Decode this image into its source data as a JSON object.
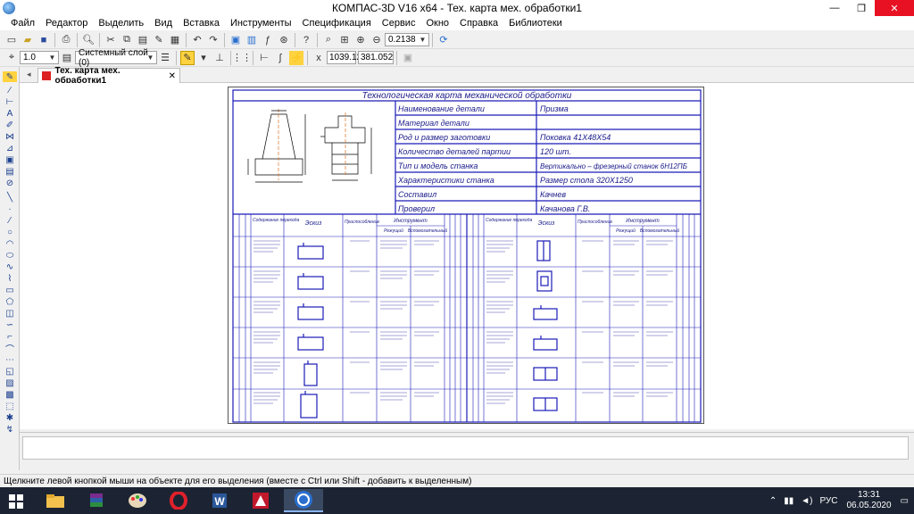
{
  "window": {
    "title": "КОМПАС-3D V16  x64 - Тех. карта мех. обработки1",
    "minimize": "—",
    "maximize": "❐",
    "close": "✕"
  },
  "menu": [
    "Файл",
    "Редактор",
    "Выделить",
    "Вид",
    "Вставка",
    "Инструменты",
    "Спецификация",
    "Сервис",
    "Окно",
    "Справка",
    "Библиотеки"
  ],
  "toolbar1": {
    "zoom_value": "0.2138"
  },
  "toolbar2": {
    "line_scale": "1.0",
    "layer": "Системный слой (0)",
    "coord_x": "1039.12",
    "coord_y": "381.052"
  },
  "tab": {
    "label": "Тех. карта мех. обработки1",
    "close": "✕"
  },
  "sheet": {
    "title": "Технологическая карта механической обработки",
    "info_rows": [
      {
        "label": "Наименование детали",
        "value": "Призма"
      },
      {
        "label": "Материал детали",
        "value": ""
      },
      {
        "label": "Род и размер заготовки",
        "value": "Поковка 41Х48Х54"
      },
      {
        "label": "Количество деталей партии",
        "value": "120 шт."
      },
      {
        "label": "Тип и модель станка",
        "value": "Вертикально – фрезерный станок 6Н12ПБ"
      },
      {
        "label": "Характеристики станка",
        "value": "Размер стола 320Х1250"
      },
      {
        "label": "Составил",
        "value": "Качнев"
      },
      {
        "label": "Проверил",
        "value": "Качанова Г.В."
      }
    ],
    "col_headers": {
      "content": "Содержание перехода",
      "sketch": "Эскиз",
      "fixture": "Приспособление",
      "tool": "Инструмент",
      "cutting": "Режущий",
      "auxiliary": "Вспомогательный"
    }
  },
  "status": {
    "hint": "Щелкните левой кнопкой мыши на объекте для его выделения (вместе с Ctrl или Shift - добавить к выделенным)"
  },
  "taskbar": {
    "lang": "РУС",
    "time": "13:31",
    "date": "06.05.2020"
  }
}
